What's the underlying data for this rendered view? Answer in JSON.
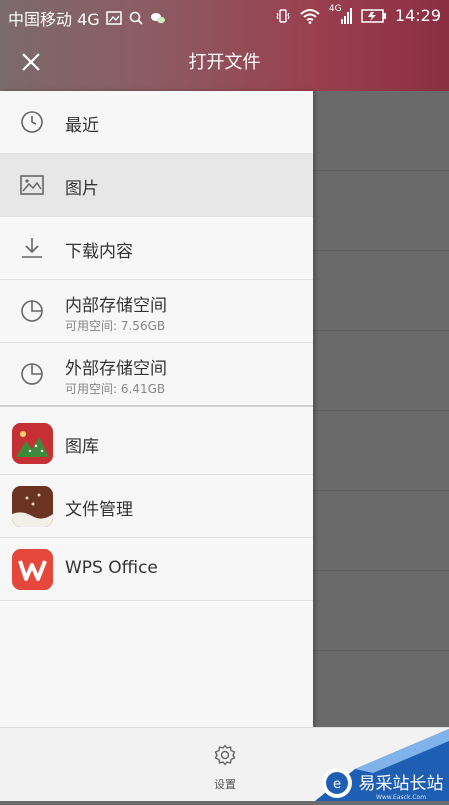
{
  "status_bar": {
    "carrier": "中国移动 4G",
    "time": "14:29",
    "network_small": "4G"
  },
  "title_bar": {
    "title": "打开文件",
    "close_icon": "close-icon"
  },
  "locations": [
    {
      "label": "最近",
      "icon": "clock-icon"
    },
    {
      "label": "图片",
      "icon": "image-icon",
      "selected": true
    },
    {
      "label": "下载内容",
      "icon": "download-icon"
    },
    {
      "label": "内部存储空间",
      "sub": "可用空间: 7.56GB",
      "icon": "storage-pie-icon"
    },
    {
      "label": "外部存储空间",
      "sub": "可用空间: 6.41GB",
      "icon": "storage-pie-icon"
    }
  ],
  "apps": [
    {
      "label": "图库",
      "icon": "gallery-app-icon"
    },
    {
      "label": "文件管理",
      "icon": "file-manager-app-icon"
    },
    {
      "label": "WPS Office",
      "icon": "wps-office-app-icon"
    }
  ],
  "bottom": {
    "settings_label": "设置"
  },
  "watermark": {
    "text": "易采站长站",
    "sub": "Www.Easck.Com"
  },
  "colors": {
    "header_accent": "#9a3f4e",
    "drawer_bg": "#f7f7f7",
    "selected_bg": "#e7e7e7",
    "wps_red": "#e5473b"
  }
}
